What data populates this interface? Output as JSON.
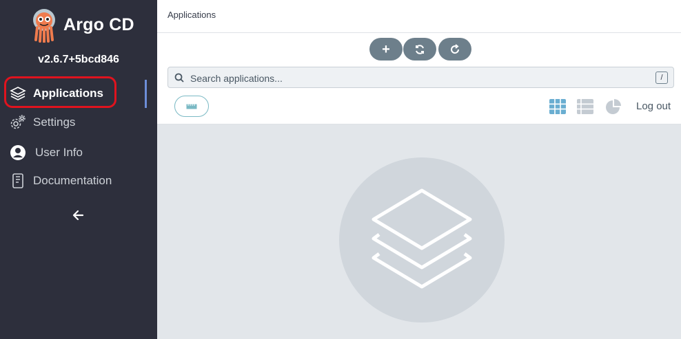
{
  "sidebar": {
    "brand": "Argo CD",
    "version": "v2.6.7+5bcd846",
    "items": [
      {
        "label": "Applications",
        "icon": "layers-icon",
        "active": true
      },
      {
        "label": "Settings",
        "icon": "gears-icon"
      },
      {
        "label": "User Info",
        "icon": "user-circle-icon"
      },
      {
        "label": "Documentation",
        "icon": "book-icon"
      }
    ],
    "collapse_icon": "arrow-left-icon"
  },
  "header": {
    "breadcrumb": "Applications"
  },
  "toolbar": {
    "buttons": [
      {
        "icon": "plus-icon",
        "label": "+"
      },
      {
        "icon": "sync-icon"
      },
      {
        "icon": "refresh-icon"
      }
    ],
    "search": {
      "placeholder": "Search applications...",
      "value": "",
      "shortcut": "/"
    },
    "views": [
      "tiles-view-icon",
      "list-view-icon",
      "pie-chart-icon"
    ],
    "logout_label": "Log out"
  },
  "colors": {
    "sidebar_bg": "#2d2f3c",
    "button_bg": "#6d7f8b",
    "active_view": "#6aaed1",
    "highlight": "#e0131e"
  }
}
